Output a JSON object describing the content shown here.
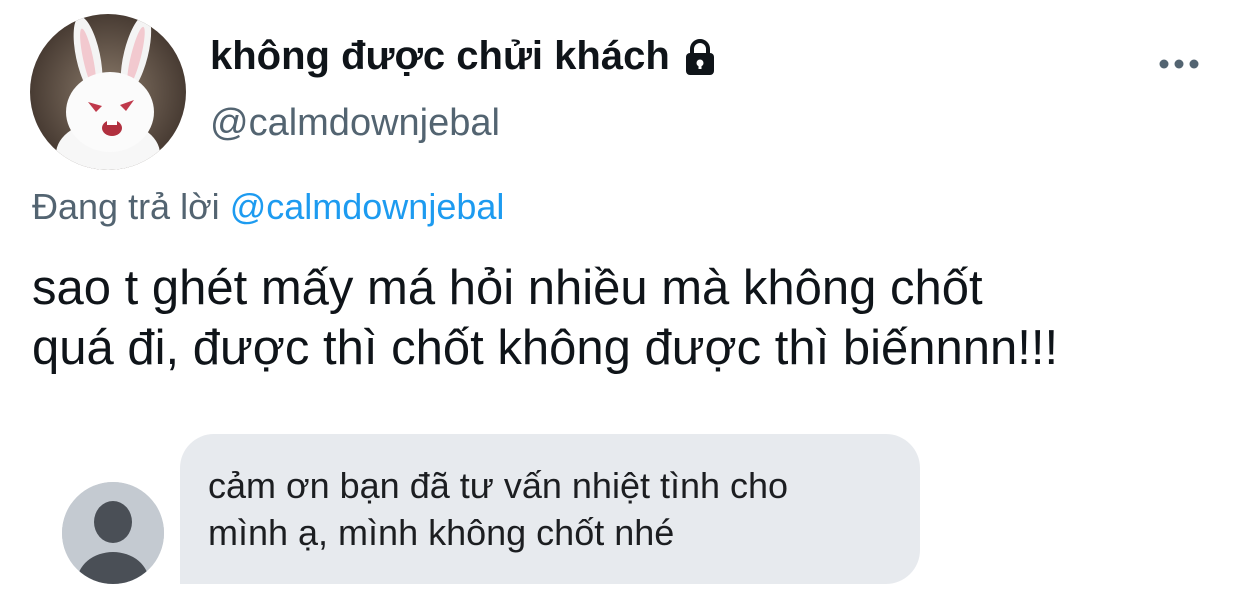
{
  "header": {
    "display_name": "không được chửi khách",
    "handle": "@calmdownjebal"
  },
  "reply": {
    "prefix": "Đang trả lời",
    "mention": "@calmdownjebal"
  },
  "tweet": {
    "lines": [
      "sao t ghét mấy má hỏi nhiều mà không chốt",
      "quá đi, được thì chốt không được thì biếnnnn!!!"
    ]
  },
  "embedded_message": {
    "lines": [
      "cảm ơn bạn đã tư vấn nhiệt tình cho",
      "mình ạ, mình không chốt nhé"
    ]
  },
  "colors": {
    "text_primary": "#0f1419",
    "text_secondary": "#536471",
    "link": "#1d9bf0",
    "bubble_bg": "#e7eaee"
  },
  "icons": {
    "lock": "lock-icon",
    "more": "more-horizontal-icon",
    "default_avatar": "default-avatar-icon"
  }
}
